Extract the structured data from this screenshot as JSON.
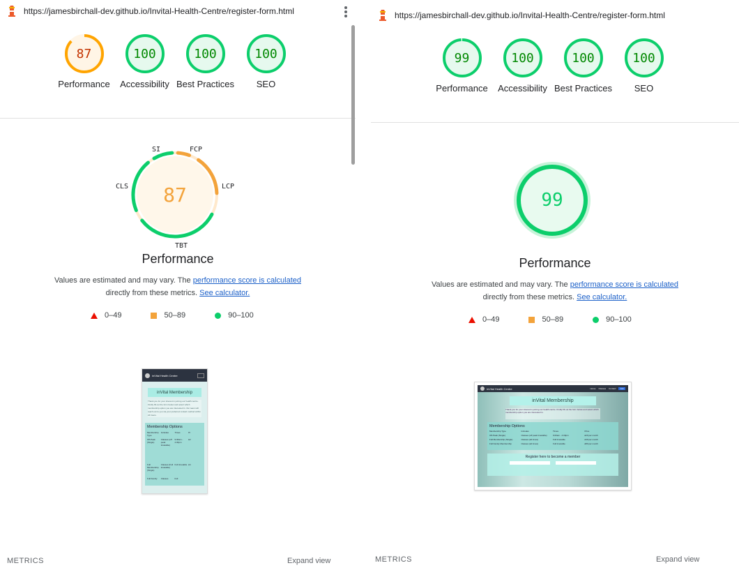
{
  "left": {
    "url": "https://jamesbirchall-dev.github.io/Invital-Health-Centre/register-form.html",
    "gauges": [
      {
        "label": "Performance",
        "score": "87",
        "level": "average"
      },
      {
        "label": "Accessibility",
        "score": "100",
        "level": "pass"
      },
      {
        "label": "Best Practices",
        "score": "100",
        "level": "pass"
      },
      {
        "label": "SEO",
        "score": "100",
        "level": "pass"
      }
    ],
    "big_score": "87",
    "metric_labels": {
      "si": "SI",
      "fcp": "FCP",
      "lcp": "LCP",
      "cls": "CLS",
      "tbt": "TBT"
    },
    "title": "Performance",
    "desc_prefix": "Values are estimated and may vary. The ",
    "desc_link1": "performance score is calculated",
    "desc_mid": "directly from these metrics. ",
    "desc_link2": "See calculator.",
    "legend": {
      "fail": "0–49",
      "average": "50–89",
      "pass": "90–100"
    },
    "metrics_label": "METRICS",
    "expand_label": "Expand view",
    "thumb": {
      "brand": "inVital Health Centre",
      "hero": "inVital Membership",
      "intro": "Thank you for your interest in joining our health centre. Kindly fill out the form below and select which membership option you are interested in. Our team will reach out to you via your preferred contact method within 24 hours.",
      "section": "Membership Options",
      "table_header": [
        "Membership Type",
        "Includes",
        "Times",
        "Pr"
      ],
      "rows": [
        [
          "Off-Peak (Single)",
          "Classes (off peak timetable)",
          "9.00am - 4.00pm",
          "£2"
        ],
        [
          "Full Membership (Single)",
          "Classes (Full timetable)",
          "Full timetable",
          "£4"
        ],
        [
          "Full Family",
          "Classes",
          "Full",
          ""
        ]
      ]
    }
  },
  "right": {
    "url": "https://jamesbirchall-dev.github.io/Invital-Health-Centre/register-form.html",
    "gauges": [
      {
        "label": "Performance",
        "score": "99",
        "level": "pass"
      },
      {
        "label": "Accessibility",
        "score": "100",
        "level": "pass"
      },
      {
        "label": "Best Practices",
        "score": "100",
        "level": "pass"
      },
      {
        "label": "SEO",
        "score": "100",
        "level": "pass"
      }
    ],
    "big_score": "99",
    "title": "Performance",
    "desc_prefix": "Values are estimated and may vary. The ",
    "desc_link1": "performance score is calculated",
    "desc_mid": "directly from these metrics. ",
    "desc_link2": "See calculator.",
    "legend": {
      "fail": "0–49",
      "average": "50–89",
      "pass": "90–100"
    },
    "metrics_label": "METRICS",
    "expand_label": "Expand view",
    "thumb": {
      "brand": "inVital Health Centre",
      "nav_links": [
        "Home",
        "Classes",
        "Contact",
        "Join"
      ],
      "hero": "inVital Membership",
      "intro": "Thank you for your interest in joining our health centre. Kindly fill out the form below and select which membership option you are interested in.",
      "section": "Membership Options",
      "table_header": [
        "Membership Type",
        "Includes",
        "Times",
        "Price"
      ],
      "rows": [
        [
          "Off-Peak (Single)",
          "Classes (off peak timetable)",
          "9.00am - 4.00pm",
          "£20 per month"
        ],
        [
          "Full Membership (Single)",
          "Classes (all times)",
          "Full timetable",
          "£40 per month"
        ],
        [
          "Full Family Membership",
          "Classes (all times)",
          "Full timetable",
          "£80 per month"
        ]
      ],
      "register": "Register here to become a member",
      "fields": [
        "Name",
        "Email"
      ]
    }
  },
  "colors": {
    "pass": "#0cce6b",
    "pass_text": "#008800",
    "average": "#ffa400",
    "average_text": "#c33300",
    "fail": "#eb0f00",
    "link": "#1a5fc8"
  }
}
